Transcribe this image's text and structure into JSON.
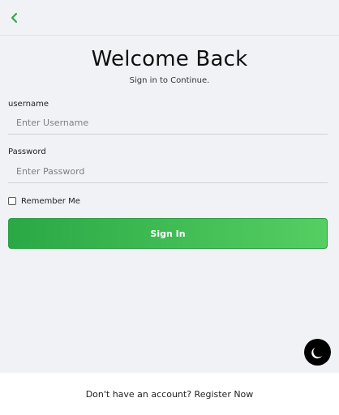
{
  "header": {
    "back_icon": "chevron-left-icon",
    "accent_color": "#2fa84f"
  },
  "main": {
    "title": "Welcome Back",
    "subtitle": "Sign in to Continue.",
    "username": {
      "label": "username",
      "placeholder": "Enter Username",
      "value": ""
    },
    "password": {
      "label": "Password",
      "placeholder": "Enter Password",
      "value": ""
    },
    "remember": {
      "label": "Remember Me",
      "checked": false
    },
    "signin_label": "Sign In",
    "signin_gradient": [
      "#2aa845",
      "#55cf62"
    ]
  },
  "theme_toggle": {
    "icon": "moon-icon",
    "background": "#000000"
  },
  "footer": {
    "text": "Don't have an account? Register Now"
  }
}
